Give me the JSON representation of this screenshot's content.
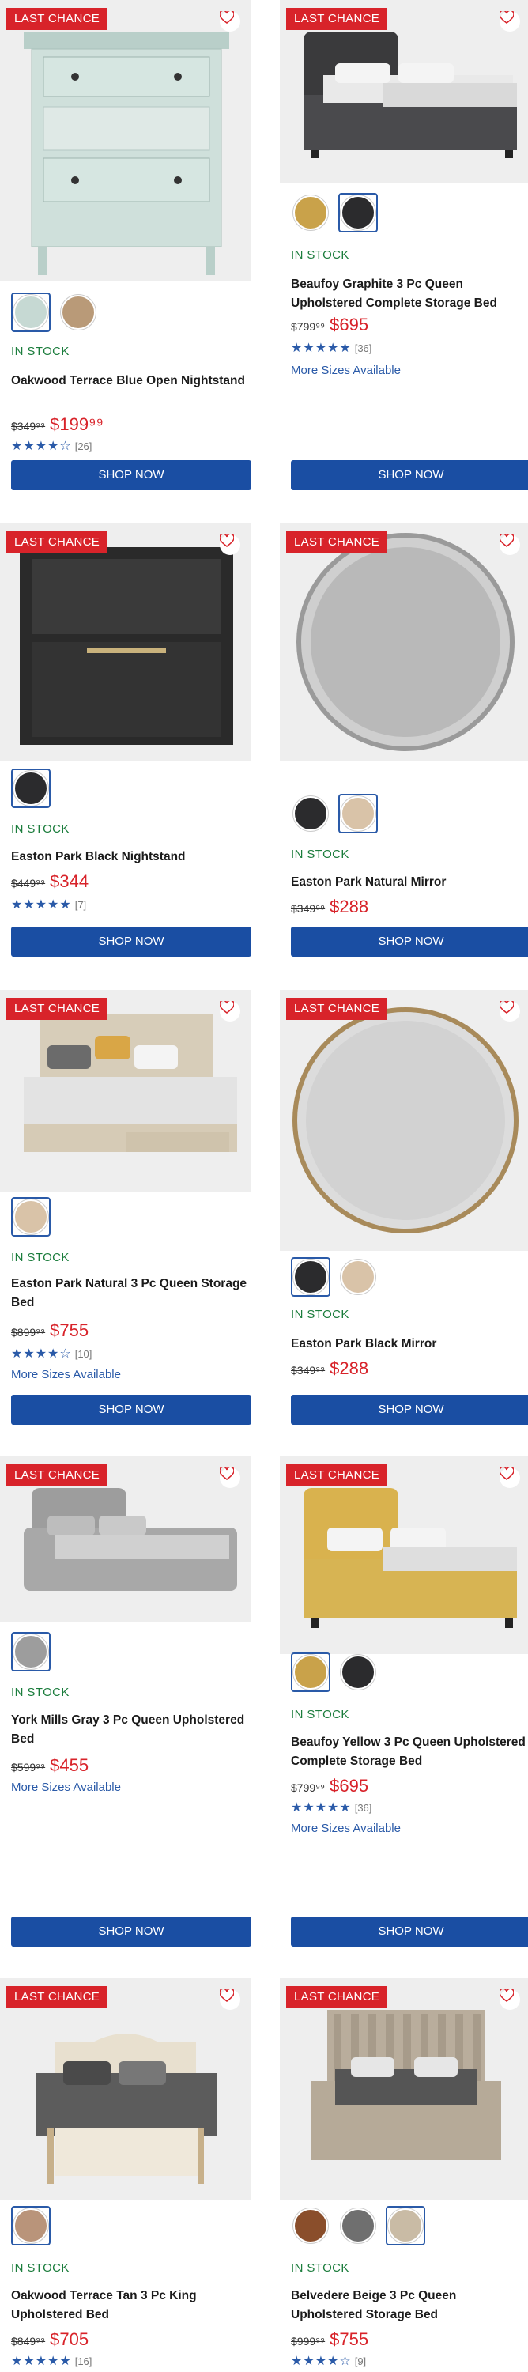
{
  "badge_label": "LAST CHANCE",
  "button_label": "SHOP NOW",
  "colors": {
    "badge": "#d8232a",
    "button": "#1a4ea3",
    "stock": "#1c7d3d",
    "price": "#d8232a",
    "link": "#2a5aa8"
  },
  "products": [
    {
      "name": "Oakwood Terrace Blue Open Nightstand",
      "stock": "IN STOCK",
      "old_price": "$349⁹⁹",
      "new_price": "$199⁹⁹",
      "stars": "★★★★☆",
      "reviews": "[26]",
      "more": ""
    },
    {
      "name": "Beaufoy Graphite 3 Pc Queen Upholstered Complete Storage Bed",
      "stock": "IN STOCK",
      "old_price": "$799⁹⁹",
      "new_price": "$695",
      "stars": "★★★★★",
      "reviews": "[36]",
      "more": "More Sizes Available"
    },
    {
      "name": "Easton Park Black Nightstand",
      "stock": "IN STOCK",
      "old_price": "$449⁹⁹",
      "new_price": "$344",
      "stars": "★★★★★",
      "reviews": "[7]",
      "more": ""
    },
    {
      "name": "Easton Park Natural Mirror",
      "stock": "IN STOCK",
      "old_price": "$349⁹⁹",
      "new_price": "$288",
      "stars": "",
      "reviews": "",
      "more": ""
    },
    {
      "name": "Easton Park Natural 3 Pc Queen Storage Bed",
      "stock": "IN STOCK",
      "old_price": "$899⁹⁹",
      "new_price": "$755",
      "stars": "★★★★☆",
      "reviews": "[10]",
      "more": "More Sizes Available"
    },
    {
      "name": "Easton Park Black Mirror",
      "stock": "IN STOCK",
      "old_price": "$349⁹⁹",
      "new_price": "$288",
      "stars": "",
      "reviews": "",
      "more": ""
    },
    {
      "name": "York Mills Gray 3 Pc Queen Upholstered Bed",
      "stock": "IN STOCK",
      "old_price": "$599⁹⁹",
      "new_price": "$455",
      "stars": "",
      "reviews": "",
      "more": "More Sizes Available"
    },
    {
      "name": "Beaufoy Yellow 3 Pc Queen Upholstered Complete Storage Bed",
      "stock": "IN STOCK",
      "old_price": "$799⁹⁹",
      "new_price": "$695",
      "stars": "★★★★★",
      "reviews": "[36]",
      "more": "More Sizes Available"
    },
    {
      "name": "Oakwood Terrace Tan 3 Pc King Upholstered Bed",
      "stock": "IN STOCK",
      "old_price": "$849⁹⁹",
      "new_price": "$705",
      "stars": "★★★★★",
      "reviews": "[16]",
      "more": ""
    },
    {
      "name": "Belvedere Beige 3 Pc Queen Upholstered Storage Bed",
      "stock": "IN STOCK",
      "old_price": "$999⁹⁹",
      "new_price": "$755",
      "stars": "★★★★☆",
      "reviews": "[9]",
      "more": ""
    }
  ]
}
